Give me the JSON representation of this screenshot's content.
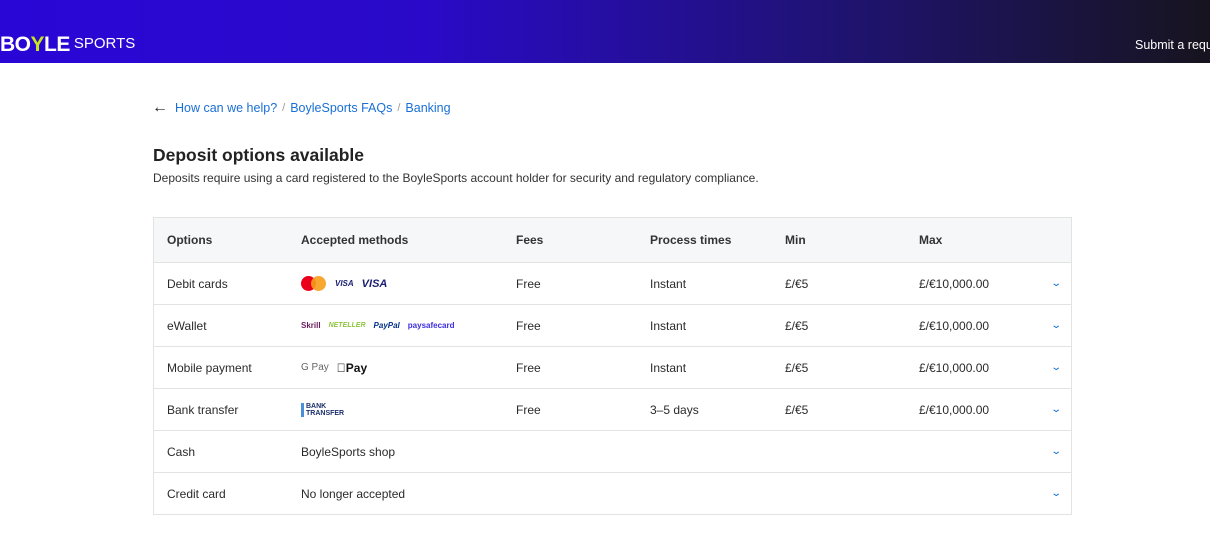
{
  "header": {
    "logo": {
      "boy": "BO",
      "y": "Y",
      "le": "LE",
      "sports": "SPORTS"
    },
    "submit_label": "Submit a request"
  },
  "breadcrumb": [
    {
      "label": "How can we help?"
    },
    {
      "label": "BoyleSports FAQs"
    },
    {
      "label": "Banking"
    }
  ],
  "page": {
    "title": "Deposit options available",
    "subtitle": "Deposits require using a card registered to the BoyleSports account holder for security and regulatory compliance."
  },
  "table": {
    "headers": [
      "Options",
      "Accepted methods",
      "Fees",
      "Process times",
      "Min",
      "Max"
    ],
    "rows": [
      {
        "option": "Debit cards",
        "methods": "",
        "logos": [
          "mastercard",
          "VISA",
          "VISA"
        ],
        "fees": "Free",
        "time": "Instant",
        "min": "£/€5",
        "max": "£/€10,000.00"
      },
      {
        "option": "eWallet",
        "methods": "",
        "logos": [
          "Skrill",
          "NETELLER",
          "PayPal",
          "paysafecard"
        ],
        "fees": "Free",
        "time": "Instant",
        "min": "£/€5",
        "max": "£/€10,000.00"
      },
      {
        "option": "Mobile payment",
        "methods": "",
        "logos": [
          "G Pay",
          "Pay"
        ],
        "fees": "Free",
        "time": "Instant",
        "min": "£/€5",
        "max": "£/€10,000.00"
      },
      {
        "option": "Bank transfer",
        "methods": "",
        "logos": [
          "BANK TRANSFER"
        ],
        "fees": "Free",
        "time": "3–5 days",
        "min": "£/€5",
        "max": "£/€10,000.00"
      },
      {
        "option": "Cash",
        "methods": "BoyleSports shop",
        "fees": "",
        "time": "",
        "min": "",
        "max": ""
      },
      {
        "option": "Credit card",
        "methods": "No longer accepted",
        "fees": "",
        "time": "",
        "min": "",
        "max": ""
      }
    ]
  },
  "colors": {
    "link": "#1a6fd6",
    "header_start": "#2a06d6",
    "header_end": "#17141f",
    "logo_accent": "#c4e61a"
  }
}
